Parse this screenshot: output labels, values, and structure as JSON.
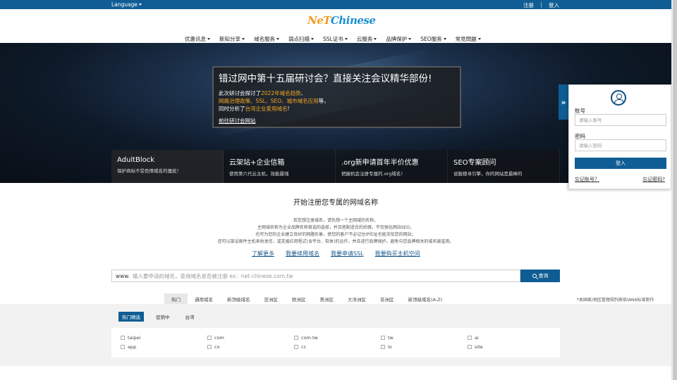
{
  "topbar": {
    "language_label": "Language",
    "register_label": "注册",
    "login_label": "登入"
  },
  "logo": {
    "part_a": "NeT",
    "part_b": "Chinese"
  },
  "nav": [
    {
      "label": "优惠讯息"
    },
    {
      "label": "新知分享"
    },
    {
      "label": "域名服务"
    },
    {
      "label": "弱点扫描"
    },
    {
      "label": "SSL证书"
    },
    {
      "label": "云服务"
    },
    {
      "label": "品牌保护"
    },
    {
      "label": "SEO服务"
    },
    {
      "label": "常見問題"
    }
  ],
  "promo": {
    "title": "错过网中第十五届研讨会？直接关注会议精华部份!",
    "line1_a": "此次研讨会探讨了",
    "line1_hl": "2022年域名趋势",
    "line1_b": "、",
    "line2_hl": "网路治理政策、SSL、SEO、城市域名应用",
    "line2_b": "等，",
    "line3_a": "同时分析了",
    "line3_hl": "台湾企业爱用域名",
    "line3_b": "!",
    "link": "前往研讨会网站"
  },
  "features": [
    {
      "title": "AdultBlock",
      "desc": "保护商标不受色情域名的骚扰！"
    },
    {
      "title": "云架站+企业信箱",
      "desc": "使用第六代云主机，效能最强"
    },
    {
      "title": ".org新申请首年半价优惠",
      "desc": "把握机会注册专属的.org域名！"
    },
    {
      "title": "SEO专案顾问",
      "desc": "说服搜寻引擎，你的网站是最棒的"
    }
  ],
  "login": {
    "toggle_glyph": "»",
    "account_label": "账号",
    "account_placeholder": "请输入账号",
    "password_label": "密码",
    "password_placeholder": "请输入密码",
    "submit_label": "登入",
    "forgot_account": "忘记账号？",
    "forgot_password": "忘记密码?"
  },
  "register": {
    "title": "开始注册您专属的网域名称",
    "desc": [
      "若您想注册域名，请先想一个主网域的名称。",
      "主网域名称为企业品牌名称首选的选择，并且搭配适合的后缀，不仅强化网站SEO，",
      "也可为您的企业建立良好的网路形象，使您的客户不必记住IP位址也能浏览您的网站；",
      "还可以架设邮件主机来收发信，或支援应用程式(含平台、软体)的运作，并且进行品牌保护，避免与您品牌相关的域名被滥用。"
    ],
    "cta": [
      "了解更多",
      "我要续用域名",
      "我要申请SSL",
      "我要购买主机空间"
    ]
  },
  "search": {
    "prefix": "www.",
    "placeholder": "输入要申请的域名，查询域名是否被注册 ex：net-chinese.com.tw",
    "button_label": "查询"
  },
  "tabs": [
    "热门",
    "通用域名",
    "新顶级域名",
    "亚洲区",
    "欧洲区",
    "美洲区",
    "大洋洲区",
    "非洲区",
    "新顶级域名(A-Z)"
  ],
  "iana_note": "*本国家/地区管理规列表依IANA标准制作",
  "sub_tabs": [
    "热门精选",
    "促销中",
    "台湾"
  ],
  "tlds": [
    "taipei",
    "com",
    "com.tw",
    "tw",
    "ai",
    "app",
    "co",
    "cc",
    "io",
    "site"
  ],
  "colors": {
    "brand_blue": "#0f5d94",
    "highlight_orange": "#f5a623"
  }
}
